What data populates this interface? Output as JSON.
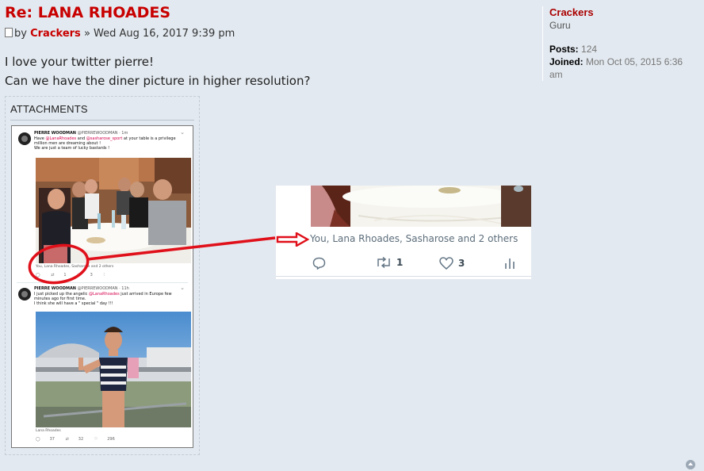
{
  "post": {
    "title": "Re: LANA RHOADES",
    "by": "by",
    "author": "Crackers",
    "separator": "»",
    "date": "Wed Aug 16, 2017 9:39 pm",
    "body_line1": "I love your twitter pierre!",
    "body_line2": "Can we have the diner picture in higher resolution?"
  },
  "attachments": {
    "title": "ATTACHMENTS"
  },
  "tweet1": {
    "name": "PIERRE WOODMAN",
    "handle": "@PIERREWOODMAN",
    "time": "· 1m",
    "text_a": "Have",
    "mention_a": "@LanaRhoades",
    "text_b": "and",
    "mention_b": "@sasharose_sport",
    "text_c": "at your table is a privilege",
    "line2": "million men are dreaming about !",
    "line3": "We are just a team of lucky bastards !",
    "likers": "You, Lana Rhoades, Sasharose and 2 others",
    "retweets": "1",
    "likes": "3"
  },
  "tweet2": {
    "name": "PIERRE WOODMAN",
    "handle": "@PIERREWOODMAN",
    "time": "· 11h",
    "text_a": "I just picked up the angelic",
    "mention_a": "@LanaRhoades",
    "text_b": "just arrived in Europe few",
    "line2": "minutes ago for first time.",
    "line3": "I think she will have a \" special \" day !!!",
    "caption": "Lana Rhoades",
    "replies": "37",
    "retweets": "32",
    "likes": "296"
  },
  "crop": {
    "likers": "You, Lana Rhoades, Sasharose and 2 others",
    "retweets": "1",
    "likes": "3"
  },
  "profile": {
    "username": "Crackers",
    "rank": "Guru",
    "posts_label": "Posts:",
    "posts_value": "124",
    "joined_label": "Joined:",
    "joined_value": "Mon Oct 05, 2015 6:36 am"
  },
  "icons": {
    "post_icon": "page-icon",
    "back_to_top": "arrow-up-icon",
    "reply": "reply-icon",
    "retweet": "retweet-icon",
    "like": "heart-icon",
    "analytics": "bar-chart-icon"
  },
  "colors": {
    "title_red": "#c80000",
    "annotation_red": "#e0101a",
    "page_bg": "#e2e9f0"
  }
}
